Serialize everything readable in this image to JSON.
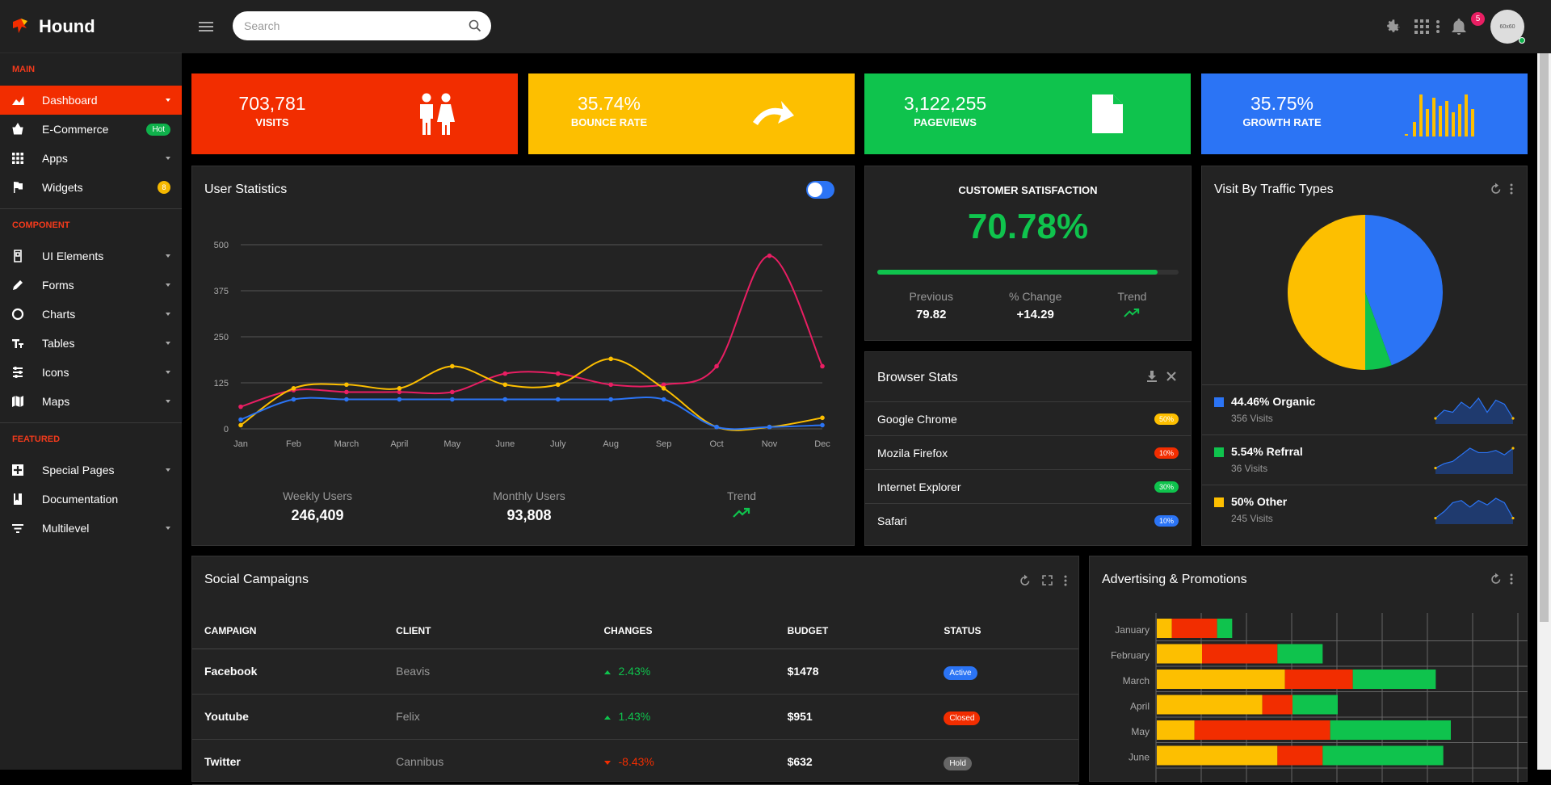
{
  "brand": {
    "name": "Hound"
  },
  "search": {
    "placeholder": "Search"
  },
  "topbar": {
    "notifications": "5",
    "avatar": "60x60"
  },
  "sidebar": {
    "sections": [
      {
        "heading": "MAIN",
        "items": [
          {
            "label": "Dashboard",
            "icon": "dashboard-icon",
            "caret": true,
            "active": true
          },
          {
            "label": "E-Commerce",
            "icon": "basket-icon",
            "badge": "Hot"
          },
          {
            "label": "Apps",
            "icon": "apps-icon",
            "caret": true
          },
          {
            "label": "Widgets",
            "icon": "flag-icon",
            "count": "8"
          }
        ]
      },
      {
        "heading": "COMPONENT",
        "items": [
          {
            "label": "UI Elements",
            "icon": "ui-elements-icon",
            "caret": true
          },
          {
            "label": "Forms",
            "icon": "pencil-icon",
            "caret": true
          },
          {
            "label": "Charts",
            "icon": "chart-icon",
            "caret": true
          },
          {
            "label": "Tables",
            "icon": "table-icon",
            "caret": true
          },
          {
            "label": "Icons",
            "icon": "icons-icon",
            "caret": true
          },
          {
            "label": "Maps",
            "icon": "map-icon",
            "caret": true
          }
        ]
      },
      {
        "heading": "FEATURED",
        "items": [
          {
            "label": "Special Pages",
            "icon": "special-pages-icon",
            "caret": true
          },
          {
            "label": "Documentation",
            "icon": "book-icon"
          },
          {
            "label": "Multilevel",
            "icon": "filter-icon",
            "caret": true
          }
        ]
      }
    ]
  },
  "stats": [
    {
      "value": "703,781",
      "label": "VISITS",
      "color": "#f22d00",
      "icon": "people-icon"
    },
    {
      "value": "35.74%",
      "label": "BOUNCE RATE",
      "color": "#fdbf00",
      "icon": "redo-arrow-icon"
    },
    {
      "value": "3,122,255",
      "label": "PAGEVIEWS",
      "color": "#0fc34d",
      "icon": "document-icon"
    },
    {
      "value": "35.75%",
      "label": "GROWTH RATE",
      "color": "#2b74f5",
      "icon": "bar-sparkline-icon"
    }
  ],
  "user_stats": {
    "title": "User Statistics",
    "footer": [
      {
        "label": "Weekly Users",
        "value": "246,409"
      },
      {
        "label": "Monthly Users",
        "value": "93,808"
      },
      {
        "label": "Trend",
        "icon": "trend-up-icon"
      }
    ],
    "chart_data": {
      "type": "line",
      "categories": [
        "Jan",
        "Feb",
        "March",
        "April",
        "May",
        "June",
        "July",
        "Aug",
        "Sep",
        "Oct",
        "Nov",
        "Dec"
      ],
      "ylim": [
        0,
        500
      ],
      "yticks": [
        0,
        125,
        250,
        375,
        500
      ],
      "grid": true,
      "series": [
        {
          "color": "#e91e63",
          "values": [
            60,
            105,
            100,
            100,
            100,
            150,
            150,
            120,
            120,
            170,
            470,
            170
          ]
        },
        {
          "color": "#fdbf00",
          "values": [
            10,
            110,
            120,
            110,
            170,
            120,
            120,
            190,
            110,
            5,
            5,
            30
          ]
        },
        {
          "color": "#2b74f5",
          "values": [
            25,
            80,
            80,
            80,
            80,
            80,
            80,
            80,
            80,
            5,
            5,
            10
          ]
        }
      ]
    }
  },
  "satisfaction": {
    "title": "CUSTOMER SATISFACTION",
    "value": "70.78%",
    "progress": 0.93,
    "items": [
      {
        "label": "Previous",
        "value": "79.82"
      },
      {
        "label": "% Change",
        "value": "+14.29"
      },
      {
        "label": "Trend",
        "icon": "trend-up-icon"
      }
    ]
  },
  "browser": {
    "title": "Browser Stats",
    "rows": [
      {
        "name": "Google Chrome",
        "pct": "50%",
        "color": "#fdbf00"
      },
      {
        "name": "Mozila Firefox",
        "pct": "10%",
        "color": "#f22d00"
      },
      {
        "name": "Internet Explorer",
        "pct": "30%",
        "color": "#0fc34d"
      },
      {
        "name": "Safari",
        "pct": "10%",
        "color": "#2b74f5"
      }
    ]
  },
  "traffic": {
    "title": "Visit By Traffic Types",
    "chart_data": {
      "type": "pie",
      "series": [
        {
          "name": "Organic",
          "value": 44.46,
          "color": "#2b74f5"
        },
        {
          "name": "Refrral",
          "value": 5.54,
          "color": "#0fc34d"
        },
        {
          "name": "Other",
          "value": 50,
          "color": "#fdbf00"
        }
      ]
    },
    "legend": [
      {
        "label": "44.46% Organic",
        "sub": "356 Visits",
        "color": "#2b74f5",
        "spark": [
          2,
          6,
          5,
          10,
          7,
          12,
          5,
          11,
          9,
          2
        ]
      },
      {
        "label": "5.54% Refrral",
        "sub": "36 Visits",
        "color": "#0fc34d",
        "spark": [
          2,
          4,
          5,
          8,
          11,
          9,
          9,
          10,
          8,
          11
        ]
      },
      {
        "label": "50% Other",
        "sub": "245 Visits",
        "color": "#fdbf00",
        "spark": [
          2,
          5,
          9,
          10,
          7,
          10,
          8,
          11,
          9,
          2
        ]
      }
    ]
  },
  "social": {
    "title": "Social Campaigns",
    "columns": [
      "CAMPAIGN",
      "CLIENT",
      "CHANGES",
      "BUDGET",
      "STATUS"
    ],
    "rows": [
      {
        "campaign": "Facebook",
        "client": "Beavis",
        "change": "2.43%",
        "up": true,
        "budget": "$1478",
        "status": "Active",
        "status_color": "#2b74f5"
      },
      {
        "campaign": "Youtube",
        "client": "Felix",
        "change": "1.43%",
        "up": true,
        "budget": "$951",
        "status": "Closed",
        "status_color": "#f22d00"
      },
      {
        "campaign": "Twitter",
        "client": "Cannibus",
        "change": "-8.43%",
        "up": false,
        "budget": "$632",
        "status": "Hold",
        "status_color": "#666666"
      }
    ]
  },
  "ads": {
    "title": "Advertising & Promotions",
    "chart_data": {
      "type": "bar",
      "orientation": "horizontal",
      "stacked": true,
      "categories": [
        "January",
        "February",
        "March",
        "April",
        "May",
        "June"
      ],
      "series": [
        {
          "color": "#fdbf00",
          "values": [
            2,
            6,
            17,
            14,
            5,
            16
          ]
        },
        {
          "color": "#f22d00",
          "values": [
            6,
            10,
            9,
            4,
            18,
            6
          ]
        },
        {
          "color": "#0fc34d",
          "values": [
            2,
            6,
            11,
            6,
            16,
            16
          ]
        }
      ]
    }
  }
}
